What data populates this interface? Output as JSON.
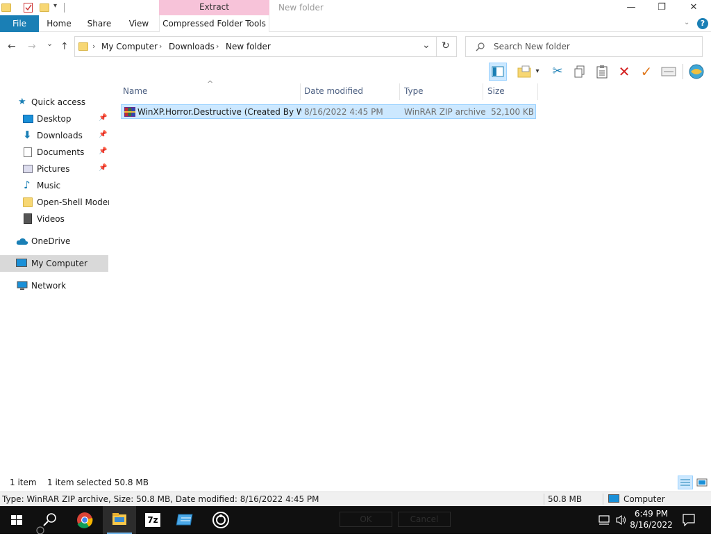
{
  "window": {
    "title": "New folder",
    "context_tab_group": "Extract",
    "minimize_glyph": "—",
    "maximize_glyph": "❐",
    "close_glyph": "✕"
  },
  "ribbon": {
    "tabs": [
      "File",
      "Home",
      "Share",
      "View",
      "Compressed Folder Tools"
    ],
    "help_glyph": "?",
    "collapse_glyph": "⌄"
  },
  "navigation": {
    "back_glyph": "←",
    "forward_glyph": "→",
    "recent_glyph": "⌄",
    "up_glyph": "↑",
    "breadcrumb": [
      "My Computer",
      "Downloads",
      "New folder"
    ],
    "refresh_glyph": "↻",
    "dropdown_glyph": "⌄",
    "search_placeholder": "Search New folder"
  },
  "nav_pane": {
    "items": [
      {
        "label": "Quick access",
        "icon": "star-icon",
        "pinned": false
      },
      {
        "label": "Desktop",
        "icon": "desktop-icon",
        "pinned": true
      },
      {
        "label": "Downloads",
        "icon": "download-icon",
        "pinned": true
      },
      {
        "label": "Documents",
        "icon": "document-icon",
        "pinned": true
      },
      {
        "label": "Pictures",
        "icon": "picture-icon",
        "pinned": true
      },
      {
        "label": "Music",
        "icon": "music-icon",
        "pinned": false
      },
      {
        "label": "Open-Shell Modern",
        "icon": "folder-icon",
        "pinned": false
      },
      {
        "label": "Videos",
        "icon": "video-icon",
        "pinned": false
      },
      {
        "label": "OneDrive",
        "icon": "cloud-icon",
        "pinned": false
      },
      {
        "label": "My Computer",
        "icon": "computer-icon",
        "pinned": false,
        "selected": true
      },
      {
        "label": "Network",
        "icon": "network-icon",
        "pinned": false
      }
    ],
    "pin_glyph": "📌"
  },
  "file_list": {
    "columns": [
      "Name",
      "Date modified",
      "Type",
      "Size"
    ],
    "sort_glyph": "^",
    "rows": [
      {
        "name": "WinXP.Horror.Destructive  (Created By W...",
        "date_modified": "8/16/2022 4:45 PM",
        "type": "WinRAR ZIP archive",
        "size": "52,100 KB",
        "selected": true
      }
    ]
  },
  "status": {
    "item_count": "1 item",
    "selection": "1 item selected  50.8 MB"
  },
  "details": {
    "info": "Type: WinRAR ZIP archive, Size: 50.8 MB, Date modified: 8/16/2022 4:45 PM",
    "size": "50.8 MB",
    "location": "Computer"
  },
  "taskbar": {
    "time": "6:49 PM",
    "date": "8/16/2022",
    "ghost_ok": "OK",
    "ghost_cancel": "Cancel",
    "seven_zip_label": "7z"
  },
  "colors": {
    "accent": "#1a7fb5",
    "selection_bg": "#cce8ff",
    "selection_border": "#99d1ff",
    "context_tab": "#f7c3d9",
    "taskbar": "#101010"
  }
}
